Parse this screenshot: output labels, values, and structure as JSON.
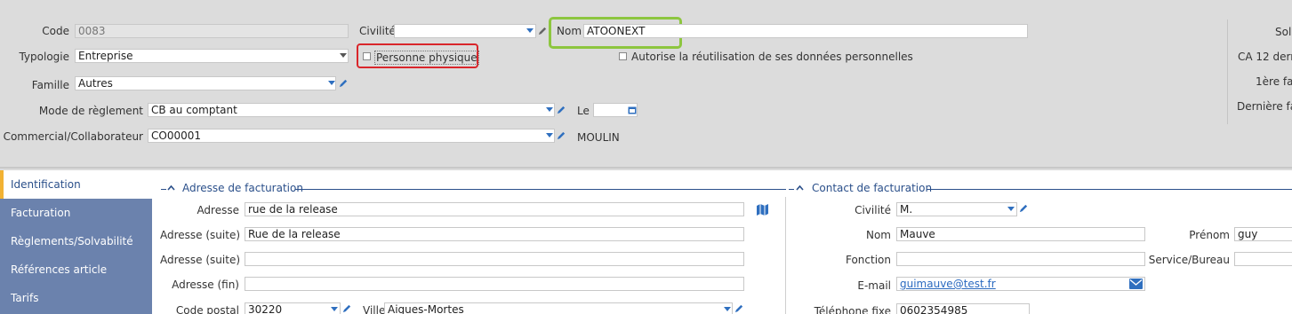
{
  "header": {
    "code": {
      "label": "Code",
      "value": "0083"
    },
    "civilite": {
      "label": "Civilité",
      "value": ""
    },
    "nom": {
      "label": "Nom",
      "value": "ATOONEXT"
    },
    "typologie": {
      "label": "Typologie",
      "value": "Entreprise"
    },
    "personne_physique": {
      "label": "Personne physique",
      "checked": false
    },
    "autorise": {
      "label": "Autorise la réutilisation de ses données personnelles",
      "checked": false
    },
    "famille": {
      "label": "Famille",
      "value": "Autres"
    },
    "mode_reglement": {
      "label": "Mode de règlement",
      "value": "CB au comptant"
    },
    "le": {
      "label": "Le",
      "value": ""
    },
    "commercial": {
      "label": "Commercial/Collaborateur",
      "value": "CO00001",
      "name": "MOULIN"
    }
  },
  "right_panel": {
    "labels": [
      "Sol",
      "CA 12 derni",
      "1ère fa",
      "Dernière fa"
    ]
  },
  "sidebar": {
    "items": [
      {
        "label": "Identification",
        "active": true
      },
      {
        "label": "Facturation",
        "active": false
      },
      {
        "label": "Règlements/Solvabilité",
        "active": false
      },
      {
        "label": "Références article",
        "active": false
      },
      {
        "label": "Tarifs",
        "active": false
      }
    ]
  },
  "billing_address": {
    "title": "Adresse de facturation",
    "adresse": {
      "label": "Adresse",
      "value": "rue de la release"
    },
    "adresse_suite1": {
      "label": "Adresse (suite)",
      "value": "Rue de la release"
    },
    "adresse_suite2": {
      "label": "Adresse (suite)",
      "value": ""
    },
    "adresse_fin": {
      "label": "Adresse (fin)",
      "value": ""
    },
    "code_postal": {
      "label": "Code postal",
      "value": "30220"
    },
    "ville": {
      "label": "Ville",
      "value": "Aigues-Mortes"
    }
  },
  "billing_contact": {
    "title": "Contact de facturation",
    "civilite": {
      "label": "Civilité",
      "value": "M."
    },
    "nom": {
      "label": "Nom",
      "value": "Mauve"
    },
    "prenom": {
      "label": "Prénom",
      "value": "guy"
    },
    "fonction": {
      "label": "Fonction",
      "value": ""
    },
    "service": {
      "label": "Service/Bureau",
      "value": ""
    },
    "email": {
      "label": "E-mail",
      "value": "guimauve@test.fr"
    },
    "telephone": {
      "label": "Téléphone fixe",
      "value": "0602354985"
    }
  },
  "colors": {
    "accent": "#2a4f8a",
    "sidebar": "#6b82ad",
    "highlight_red": "#d9262b",
    "highlight_green": "#8dc63f",
    "active_marker": "#f2b233"
  }
}
